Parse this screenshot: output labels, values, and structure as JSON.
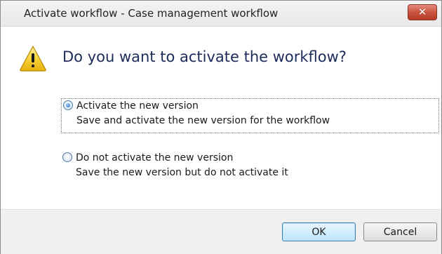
{
  "window": {
    "title": "Activate workflow - Case management workflow",
    "close_glyph": "✕"
  },
  "icons": {
    "warning": "warning-triangle-icon",
    "close": "close-icon"
  },
  "prompt": {
    "headline": "Do you want to activate the workflow?"
  },
  "options": [
    {
      "label": "Activate the new version",
      "description": "Save and activate the new version for the workflow",
      "selected": true
    },
    {
      "label": "Do not activate the new version",
      "description": "Save the new version but do not activate it",
      "selected": false
    }
  ],
  "buttons": {
    "ok_label": "OK",
    "cancel_label": "Cancel"
  },
  "colors": {
    "headline": "#1d2b5a",
    "close_button": "#c7503c",
    "warning_fill": "#f7d23a",
    "default_button_border": "#3c7fb1"
  }
}
